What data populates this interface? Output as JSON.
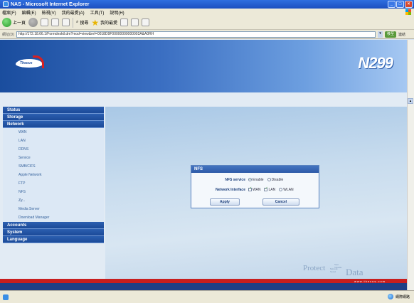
{
  "window": {
    "title": "NAS - Microsoft Internet Explorer",
    "menu": [
      "檔案(F)",
      "編輯(E)",
      "檢視(V)",
      "我的最愛(A)",
      "工具(T)",
      "說明(H)"
    ]
  },
  "toolbar": {
    "back_label": "上一頁",
    "search_label": "搜尋",
    "favorites_label": "我的最愛"
  },
  "address": {
    "label": "網址(D)",
    "url": "http://172.18.66.1/Formdesktl.dm?mod=view&ref=0018D9F00000000000002A&A0RH",
    "go_label": "移至",
    "links_label": "連結"
  },
  "header": {
    "brand": "Thecus",
    "model": "N299"
  },
  "sidebar": {
    "status": "Status",
    "storage": "Storage",
    "network": "Network",
    "network_items": [
      "WAN",
      "LAN",
      "DDNS",
      "Service",
      "SMB/CIFS",
      "Apple Network",
      "FTP",
      "NFS",
      "Zy..."
    ],
    "extra_items": [
      "Media Server",
      "Download Manager"
    ],
    "accounts": "Accounts",
    "system": "System",
    "language": "Language"
  },
  "dialog": {
    "title": "NFS",
    "service_label": "NFS service",
    "enable_label": "Enable",
    "disable_label": "Disable",
    "service_enabled": true,
    "interface_label": "Network Interface",
    "wan_label": "WAN",
    "lan_label": "LAN",
    "wlan_label": "WLAN",
    "wan_checked": true,
    "lan_checked": true,
    "wlan_checked": false,
    "apply_label": "Apply",
    "cancel_label": "Cancel"
  },
  "watermark": {
    "protect": "Protect",
    "small_top": "Your Valuable",
    "small_mid": "Network Stored",
    "data": "Data"
  },
  "footer": {
    "url": "www.thecus.com"
  },
  "statusbar": {
    "zone": "網際網路"
  },
  "colors": {
    "nav_head": "#1b4a98",
    "footer_red": "#c81e1e",
    "footer_blue": "#1f3f86",
    "dialog_border": "#5b84c0"
  }
}
